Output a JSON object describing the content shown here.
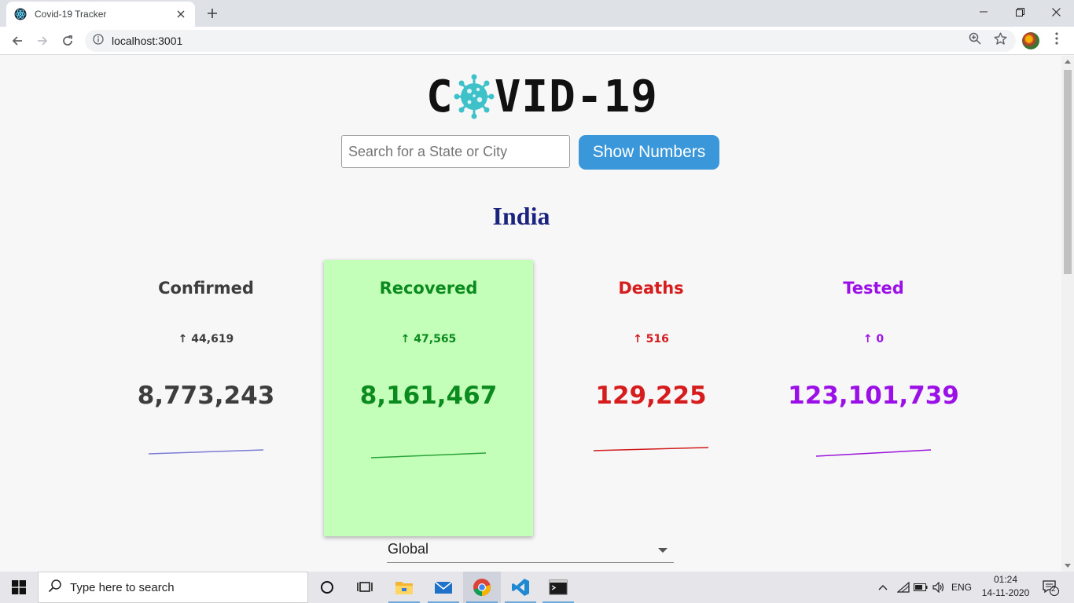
{
  "browser": {
    "tab_title": "Covid-19 Tracker",
    "url": "localhost:3001"
  },
  "page": {
    "logo_left": "C",
    "logo_right": "VID-19",
    "search_placeholder": "Search for a State or City",
    "search_button": "Show Numbers",
    "region_title": "India",
    "stats": [
      {
        "label": "Confirmed",
        "delta": "↑ 44,619",
        "total": "8,773,243",
        "color": "#3d3d3d",
        "line_color": "#7b7bd6",
        "active": false
      },
      {
        "label": "Recovered",
        "delta": "↑ 47,565",
        "total": "8,161,467",
        "color": "#0b8a1e",
        "line_color": "#2aa33a",
        "active": true
      },
      {
        "label": "Deaths",
        "delta": "↑ 516",
        "total": "129,225",
        "color": "#d61c1c",
        "line_color": "#d11a1a",
        "active": false
      },
      {
        "label": "Tested",
        "delta": "↑ 0",
        "total": "123,101,739",
        "color": "#9c10e8",
        "line_color": "#9a15d9",
        "active": false
      }
    ],
    "region_select": "Global"
  },
  "taskbar": {
    "search_placeholder": "Type here to search",
    "language": "ENG",
    "time": "01:24",
    "date": "14-11-2020",
    "notification_count": "2"
  }
}
